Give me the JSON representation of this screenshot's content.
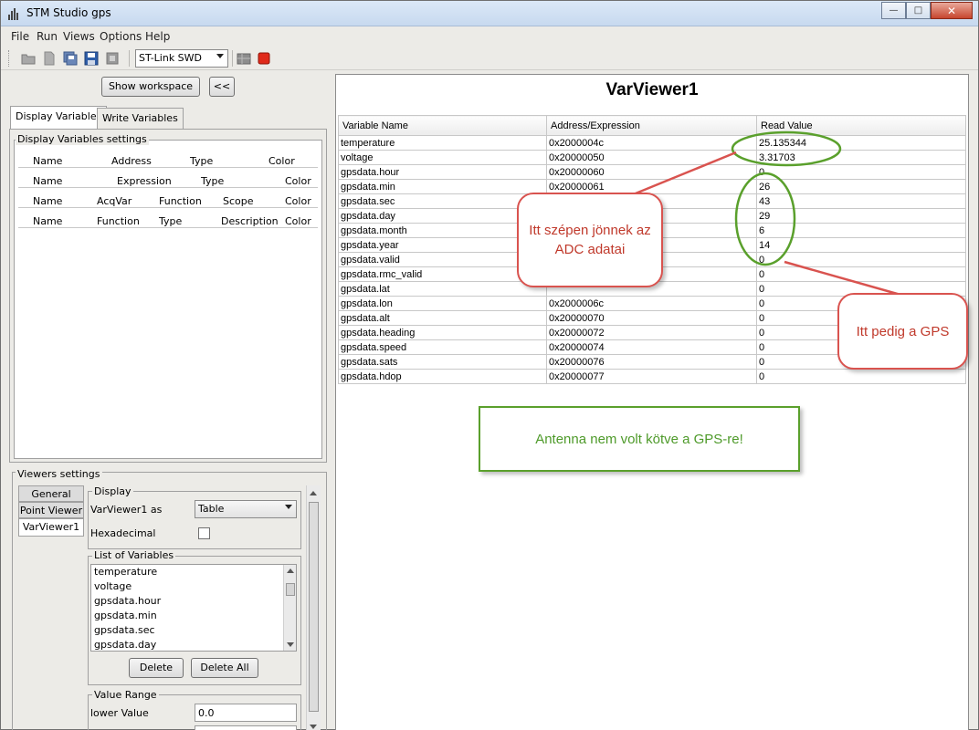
{
  "window": {
    "title": "STM Studio gps"
  },
  "menu": [
    "File",
    "Run",
    "Views",
    "Options",
    "Help"
  ],
  "toolbar": {
    "connection": "ST-Link SWD"
  },
  "left": {
    "show_workspace": "Show workspace",
    "collapse": "<<",
    "tabs": [
      "Display Variables",
      "Write Variables"
    ],
    "settings_title": "Display Variables settings",
    "header_rows": [
      [
        "Name",
        "Address",
        "Type",
        "Color"
      ],
      [
        "Name",
        "Expression",
        "Type",
        "Color"
      ],
      [
        "Name",
        "AcqVar",
        "Function",
        "Scope",
        "Color"
      ],
      [
        "Name",
        "Function",
        "Type",
        "Description",
        "Color"
      ]
    ],
    "viewers_title": "Viewers settings",
    "viewer_tabs": [
      "General",
      "Point Viewer",
      "VarViewer1"
    ],
    "display_group": "Display",
    "viewer_as_label": "VarViewer1 as",
    "viewer_as_value": "Table",
    "hexadecimal_label": "Hexadecimal",
    "list_group": "List of Variables",
    "list_items": [
      "temperature",
      "voltage",
      "gpsdata.hour",
      "gpsdata.min",
      "gpsdata.sec",
      "gpsdata.day"
    ],
    "delete": "Delete",
    "delete_all": "Delete All",
    "range_group": "Value Range",
    "lower_label": "lower Value",
    "lower_value": "0.0"
  },
  "viewer": {
    "title": "VarViewer1",
    "columns": [
      "Variable Name",
      "Address/Expression",
      "Read Value"
    ],
    "rows": [
      [
        "temperature",
        "0x2000004c",
        "25.135344"
      ],
      [
        "voltage",
        "0x20000050",
        "3.31703"
      ],
      [
        "gpsdata.hour",
        "0x20000060",
        "0"
      ],
      [
        "gpsdata.min",
        "0x20000061",
        "26"
      ],
      [
        "gpsdata.sec",
        "",
        "43"
      ],
      [
        "gpsdata.day",
        "",
        "29"
      ],
      [
        "gpsdata.month",
        "",
        "6"
      ],
      [
        "gpsdata.year",
        "",
        "14"
      ],
      [
        "gpsdata.valid",
        "",
        "0"
      ],
      [
        "gpsdata.rmc_valid",
        "",
        "0"
      ],
      [
        "gpsdata.lat",
        "",
        "0"
      ],
      [
        "gpsdata.lon",
        "0x2000006c",
        "0"
      ],
      [
        "gpsdata.alt",
        "0x20000070",
        "0"
      ],
      [
        "gpsdata.heading",
        "0x20000072",
        "0"
      ],
      [
        "gpsdata.speed",
        "0x20000074",
        "0"
      ],
      [
        "gpsdata.sats",
        "0x20000076",
        "0"
      ],
      [
        "gpsdata.hdop",
        "0x20000077",
        "0"
      ]
    ]
  },
  "annotations": {
    "adc": "Itt szépen jönnek az ADC adatai",
    "gps": "Itt pedig a GPS",
    "antenna": "Antenna nem volt kötve a GPS-re!"
  },
  "colors": {
    "red": "#d9534f",
    "green": "#5aa02c"
  }
}
